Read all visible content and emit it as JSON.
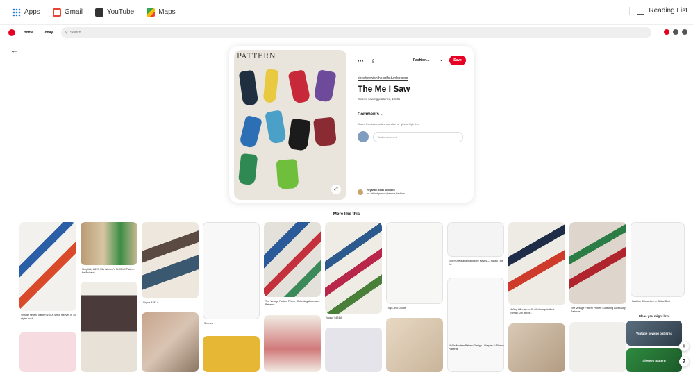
{
  "bookmarks": {
    "items": [
      {
        "label": "Apps",
        "icon": "apps-grid-icon"
      },
      {
        "label": "Gmail",
        "icon": "gmail-icon"
      },
      {
        "label": "YouTube",
        "icon": "youtube-icon"
      },
      {
        "label": "Maps",
        "icon": "maps-icon"
      }
    ],
    "reading_list": "Reading List"
  },
  "header": {
    "nav": [
      "Home",
      "Today"
    ],
    "search_placeholder": "Search",
    "accent": "#e60023"
  },
  "pin": {
    "image_title": "PATTERN",
    "board": "Fashion...",
    "save_label": "Save",
    "source": "shesheswishthesrrifs.tumblr.com",
    "title": "The Me I Saw",
    "description": "Sleeve sewing patterns, 1930s",
    "comments_label": "Comments",
    "comments_hint": "Share feedback, ask a question or give a high five",
    "comment_placeholder": "Add a comment",
    "saver_name": "Heyana Tichak saved to",
    "saver_board": "los old hollywood glamour, fashion..."
  },
  "more_like_this": "More like this",
  "grid_captions": [
    "Vintage sewing pattern 1930s set of sleeves in 10 styles bust...",
    "Simplicity 2819: 30s Women's SLEEVE Pattern for 8 sleeve...",
    "Vogue 8187 A",
    "Sleeves",
    "The Vintage Pattern Primer: Collecting Accessory Patterns",
    "Vogue 5424 A",
    "Tops and Collars",
    "Thợ mượt giang maopgime sieves — Paseo Lmb Xu",
    "Những kiểu tay áo đã cũ cho ngườ thcai — Roman Kim làm lệ...",
    "The Vintage Pattern Primer: Collecting Accessory Patterns",
    "Fashion Silhouettes — Selise Bust",
    "1940s Modern Pattern Design - Chapter 6: Sleeve Patterns"
  ],
  "ideas": {
    "heading": "Ideas you might love",
    "items": [
      "Vintage sewing patterns",
      "Sleeves pattern"
    ]
  },
  "fab": {
    "plus": "+",
    "help": "?"
  }
}
